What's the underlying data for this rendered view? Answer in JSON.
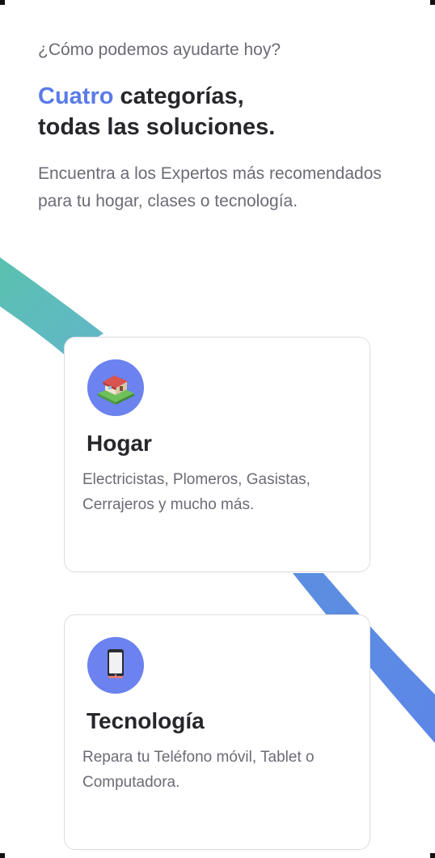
{
  "header": {
    "eyebrow": "¿Cómo podemos ayudarte hoy?",
    "headline_accent": "Cuatro",
    "headline_line1_rest": " categorías,",
    "headline_line2": "todas las soluciones.",
    "intro": "Encuentra a los Expertos más recomendados para tu hogar, clases o tecnología."
  },
  "categories": [
    {
      "icon": "house-icon",
      "title": "Hogar",
      "description": "Electricistas, Plomeros, Gasistas, Cerrajeros y mucho más."
    },
    {
      "icon": "smartphone-icon",
      "title": "Tecnología",
      "description": "Repara tu Teléfono móvil, Tablet o Computadora."
    }
  ],
  "colors": {
    "accent": "#5a7be8",
    "icon_circle": "#6b82ef",
    "ribbon_teal": "#5cbfb4",
    "ribbon_blue": "#5a90e0"
  }
}
